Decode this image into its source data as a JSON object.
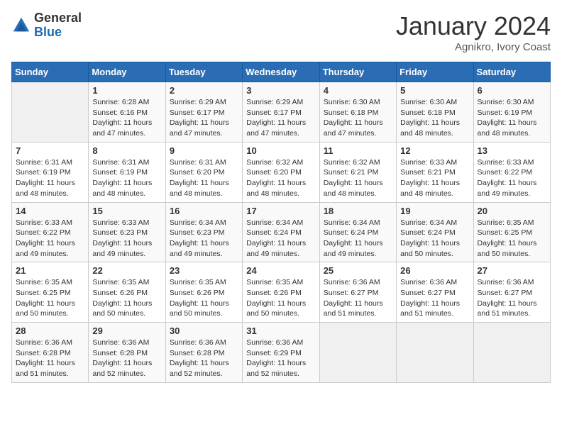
{
  "logo": {
    "general": "General",
    "blue": "Blue"
  },
  "title": "January 2024",
  "subtitle": "Agnikro, Ivory Coast",
  "days_of_week": [
    "Sunday",
    "Monday",
    "Tuesday",
    "Wednesday",
    "Thursday",
    "Friday",
    "Saturday"
  ],
  "weeks": [
    [
      {
        "day": "",
        "info": ""
      },
      {
        "day": "1",
        "info": "Sunrise: 6:28 AM\nSunset: 6:16 PM\nDaylight: 11 hours and 47 minutes."
      },
      {
        "day": "2",
        "info": "Sunrise: 6:29 AM\nSunset: 6:17 PM\nDaylight: 11 hours and 47 minutes."
      },
      {
        "day": "3",
        "info": "Sunrise: 6:29 AM\nSunset: 6:17 PM\nDaylight: 11 hours and 47 minutes."
      },
      {
        "day": "4",
        "info": "Sunrise: 6:30 AM\nSunset: 6:18 PM\nDaylight: 11 hours and 47 minutes."
      },
      {
        "day": "5",
        "info": "Sunrise: 6:30 AM\nSunset: 6:18 PM\nDaylight: 11 hours and 48 minutes."
      },
      {
        "day": "6",
        "info": "Sunrise: 6:30 AM\nSunset: 6:19 PM\nDaylight: 11 hours and 48 minutes."
      }
    ],
    [
      {
        "day": "7",
        "info": "Sunrise: 6:31 AM\nSunset: 6:19 PM\nDaylight: 11 hours and 48 minutes."
      },
      {
        "day": "8",
        "info": "Sunrise: 6:31 AM\nSunset: 6:19 PM\nDaylight: 11 hours and 48 minutes."
      },
      {
        "day": "9",
        "info": "Sunrise: 6:31 AM\nSunset: 6:20 PM\nDaylight: 11 hours and 48 minutes."
      },
      {
        "day": "10",
        "info": "Sunrise: 6:32 AM\nSunset: 6:20 PM\nDaylight: 11 hours and 48 minutes."
      },
      {
        "day": "11",
        "info": "Sunrise: 6:32 AM\nSunset: 6:21 PM\nDaylight: 11 hours and 48 minutes."
      },
      {
        "day": "12",
        "info": "Sunrise: 6:33 AM\nSunset: 6:21 PM\nDaylight: 11 hours and 48 minutes."
      },
      {
        "day": "13",
        "info": "Sunrise: 6:33 AM\nSunset: 6:22 PM\nDaylight: 11 hours and 49 minutes."
      }
    ],
    [
      {
        "day": "14",
        "info": "Sunrise: 6:33 AM\nSunset: 6:22 PM\nDaylight: 11 hours and 49 minutes."
      },
      {
        "day": "15",
        "info": "Sunrise: 6:33 AM\nSunset: 6:23 PM\nDaylight: 11 hours and 49 minutes."
      },
      {
        "day": "16",
        "info": "Sunrise: 6:34 AM\nSunset: 6:23 PM\nDaylight: 11 hours and 49 minutes."
      },
      {
        "day": "17",
        "info": "Sunrise: 6:34 AM\nSunset: 6:24 PM\nDaylight: 11 hours and 49 minutes."
      },
      {
        "day": "18",
        "info": "Sunrise: 6:34 AM\nSunset: 6:24 PM\nDaylight: 11 hours and 49 minutes."
      },
      {
        "day": "19",
        "info": "Sunrise: 6:34 AM\nSunset: 6:24 PM\nDaylight: 11 hours and 50 minutes."
      },
      {
        "day": "20",
        "info": "Sunrise: 6:35 AM\nSunset: 6:25 PM\nDaylight: 11 hours and 50 minutes."
      }
    ],
    [
      {
        "day": "21",
        "info": "Sunrise: 6:35 AM\nSunset: 6:25 PM\nDaylight: 11 hours and 50 minutes."
      },
      {
        "day": "22",
        "info": "Sunrise: 6:35 AM\nSunset: 6:26 PM\nDaylight: 11 hours and 50 minutes."
      },
      {
        "day": "23",
        "info": "Sunrise: 6:35 AM\nSunset: 6:26 PM\nDaylight: 11 hours and 50 minutes."
      },
      {
        "day": "24",
        "info": "Sunrise: 6:35 AM\nSunset: 6:26 PM\nDaylight: 11 hours and 50 minutes."
      },
      {
        "day": "25",
        "info": "Sunrise: 6:36 AM\nSunset: 6:27 PM\nDaylight: 11 hours and 51 minutes."
      },
      {
        "day": "26",
        "info": "Sunrise: 6:36 AM\nSunset: 6:27 PM\nDaylight: 11 hours and 51 minutes."
      },
      {
        "day": "27",
        "info": "Sunrise: 6:36 AM\nSunset: 6:27 PM\nDaylight: 11 hours and 51 minutes."
      }
    ],
    [
      {
        "day": "28",
        "info": "Sunrise: 6:36 AM\nSunset: 6:28 PM\nDaylight: 11 hours and 51 minutes."
      },
      {
        "day": "29",
        "info": "Sunrise: 6:36 AM\nSunset: 6:28 PM\nDaylight: 11 hours and 52 minutes."
      },
      {
        "day": "30",
        "info": "Sunrise: 6:36 AM\nSunset: 6:28 PM\nDaylight: 11 hours and 52 minutes."
      },
      {
        "day": "31",
        "info": "Sunrise: 6:36 AM\nSunset: 6:29 PM\nDaylight: 11 hours and 52 minutes."
      },
      {
        "day": "",
        "info": ""
      },
      {
        "day": "",
        "info": ""
      },
      {
        "day": "",
        "info": ""
      }
    ]
  ]
}
